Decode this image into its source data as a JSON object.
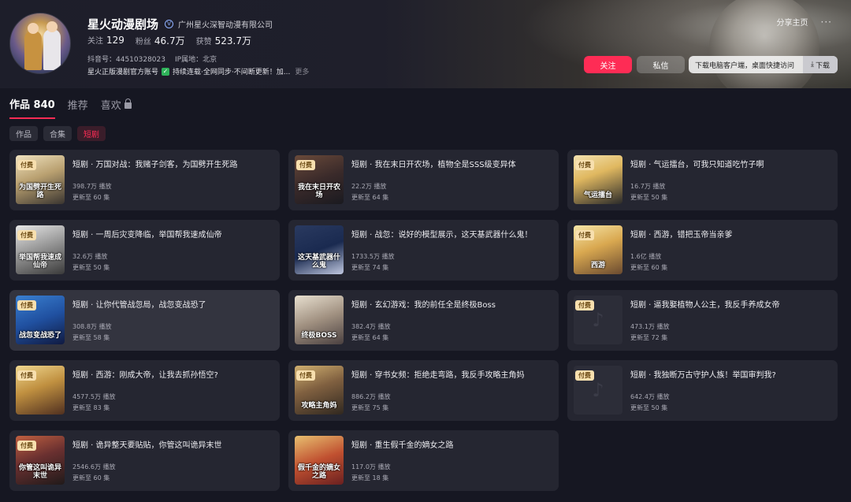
{
  "profile": {
    "name": "星火动漫剧场",
    "verified_icon": "verified-icon",
    "company": "广州星火深智动漫有限公司",
    "stats": [
      {
        "label": "关注",
        "value": "129"
      },
      {
        "label": "粉丝",
        "value": "46.7万"
      },
      {
        "label": "获赞",
        "value": "523.7万"
      }
    ],
    "douyin_id": "抖音号：44510328023",
    "ip_location": "IP属地：北京",
    "bio_part1": "星火正版漫剧官方账号",
    "bio_part2": "持续连载·全网同步·不间断更新！加...",
    "bio_more": "更多"
  },
  "top_right": {
    "share": "分享主页",
    "more": "···"
  },
  "actions": {
    "follow": "关注",
    "message": "私信",
    "download_hint": "下载电脑客户端，桌面快捷访问",
    "download_button": "下载"
  },
  "tabs": [
    {
      "label": "作品 840",
      "active": true
    },
    {
      "label": "推荐",
      "active": false
    },
    {
      "label": "喜欢",
      "active": false,
      "icon": "lock-icon"
    }
  ],
  "filters": [
    {
      "label": "作品",
      "active": false
    },
    {
      "label": "合集",
      "active": false
    },
    {
      "label": "短剧",
      "active": true
    }
  ],
  "badge_label": "付费",
  "cards": [
    {
      "title": "短剧 · 万国对战：我赌子剑客，为国劈开生死路",
      "plays": "398.7万 播放",
      "eps": "更新至 60 集",
      "thumb_text": "为国劈开生死路"
    },
    {
      "title": "短剧 · 我在末日开农场，植物全是SSS级变异体",
      "plays": "22.2万 播放",
      "eps": "更新至 64 集",
      "thumb_text": "我在末日开农场"
    },
    {
      "title": "短剧 · 气运擂台，可我只知道吃竹子啊",
      "plays": "16.7万 播放",
      "eps": "更新至 50 集",
      "thumb_text": "气运擂台"
    },
    {
      "title": "短剧 · 一周后灾变降临，举国帮我速成仙帝",
      "plays": "32.6万 播放",
      "eps": "更新至 50 集",
      "thumb_text": "举国帮我速成仙帝"
    },
    {
      "title": "短剧 · 战忽：说好的模型展示，这天基武器什么鬼！",
      "plays": "1733.5万 播放",
      "eps": "更新至 74 集",
      "thumb_text": "这天基武器什么鬼"
    },
    {
      "title": "短剧 · 西游，错把玉帝当亲爹",
      "plays": "1.6亿 播放",
      "eps": "更新至 60 集",
      "thumb_text": "西游"
    },
    {
      "title": "短剧 · 让你代管战忽局，战忽变战恐了",
      "plays": "308.8万 播放",
      "eps": "更新至 58 集",
      "thumb_text": "战忽变战恐了"
    },
    {
      "title": "短剧 · 玄幻游戏：我的前任全是终极Boss",
      "plays": "382.4万 播放",
      "eps": "更新至 64 集",
      "thumb_text": "终极BOSS"
    },
    {
      "title": "短剧 · 逼我娶植物人公主，我反手养成女帝",
      "plays": "473.1万 播放",
      "eps": "更新至 72 集",
      "thumb_text": ""
    },
    {
      "title": "短剧 · 西游：刚成大帝，让我去抓孙悟空?",
      "plays": "4577.5万 播放",
      "eps": "更新至 83 集",
      "thumb_text": ""
    },
    {
      "title": "短剧 · 穿书女频：拒绝走弯路，我反手攻略主角妈",
      "plays": "886.2万 播放",
      "eps": "更新至 75 集",
      "thumb_text": "攻略主角妈"
    },
    {
      "title": "短剧 · 我独断万古守护人族！举国审判我?",
      "plays": "642.4万 播放",
      "eps": "更新至 50 集",
      "thumb_text": ""
    },
    {
      "title": "短剧 · 诡异整天要贴贴，你管这叫诡异末世",
      "plays": "2546.6万 播放",
      "eps": "更新至 60 集",
      "thumb_text": "你管这叫诡异末世"
    },
    {
      "title": "短剧 · 重生假千金的嫡女之路",
      "plays": "117.0万 播放",
      "eps": "更新至 18 集",
      "thumb_text": "假千金的嫡女之路"
    }
  ]
}
